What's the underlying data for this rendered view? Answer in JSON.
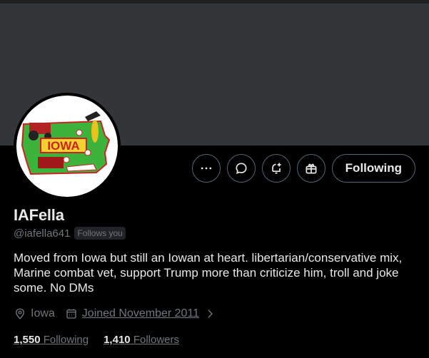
{
  "profile": {
    "name": "IAFella",
    "handle": "@iafella641",
    "follows_you": "Follows you",
    "bio": "Moved from Iowa but still an Iowan at heart. libertarian/conservative mix, Marine combat vet, support Trump more than criticize him, troll and joke some. No DMs",
    "location": "Iowa",
    "joined": "Joined November 2011",
    "following_count": "1,550",
    "following_label": "Following",
    "followers_count": "1,410",
    "followers_label": "Followers"
  },
  "actions": {
    "follow_state_label": "Following",
    "more_icon": "more-icon",
    "message_icon": "message-icon",
    "notify_icon": "bell-plus-icon",
    "subscribe_icon": "gift-icon"
  },
  "avatar": {
    "map_text": "IOWA",
    "state_color": "#3cb43c",
    "accent": "#cc2222"
  },
  "colors": {
    "background": "#000000",
    "banner": "#333639",
    "text_primary": "#e7e9ea",
    "text_secondary": "#71767b",
    "border": "#536471"
  }
}
